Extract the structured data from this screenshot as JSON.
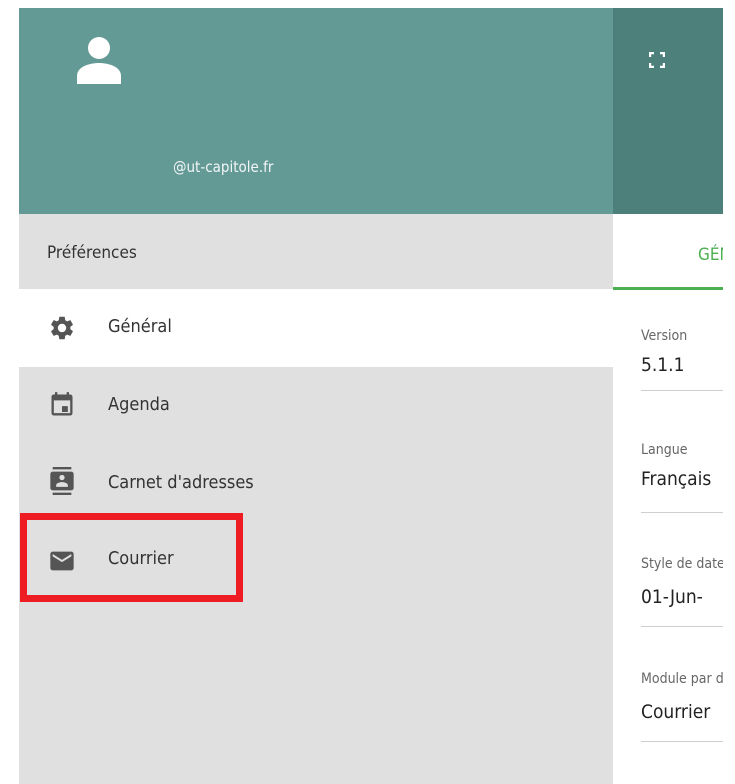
{
  "account": {
    "email": "@ut-capitole.fr"
  },
  "preferences": {
    "title": "Préférences",
    "items": [
      {
        "label": "Général",
        "icon": "gear-icon",
        "active": true
      },
      {
        "label": "Agenda",
        "icon": "calendar-icon"
      },
      {
        "label": "Carnet d'adresses",
        "icon": "contacts-icon"
      },
      {
        "label": "Courrier",
        "icon": "mail-icon"
      }
    ]
  },
  "tab": {
    "label": "GÉNÉRAL"
  },
  "fields": [
    {
      "label": "Version",
      "value": "5.1.1"
    },
    {
      "label": "Langue",
      "value": "Français"
    },
    {
      "label": "Style de date",
      "value": "01-Jun-"
    },
    {
      "label": "Module par défaut",
      "value": "Courrier"
    }
  ],
  "colors": {
    "header": "#649a96",
    "header_dark": "#4d7f7b",
    "accent": "#4caf50",
    "highlight": "#ee1d24"
  }
}
